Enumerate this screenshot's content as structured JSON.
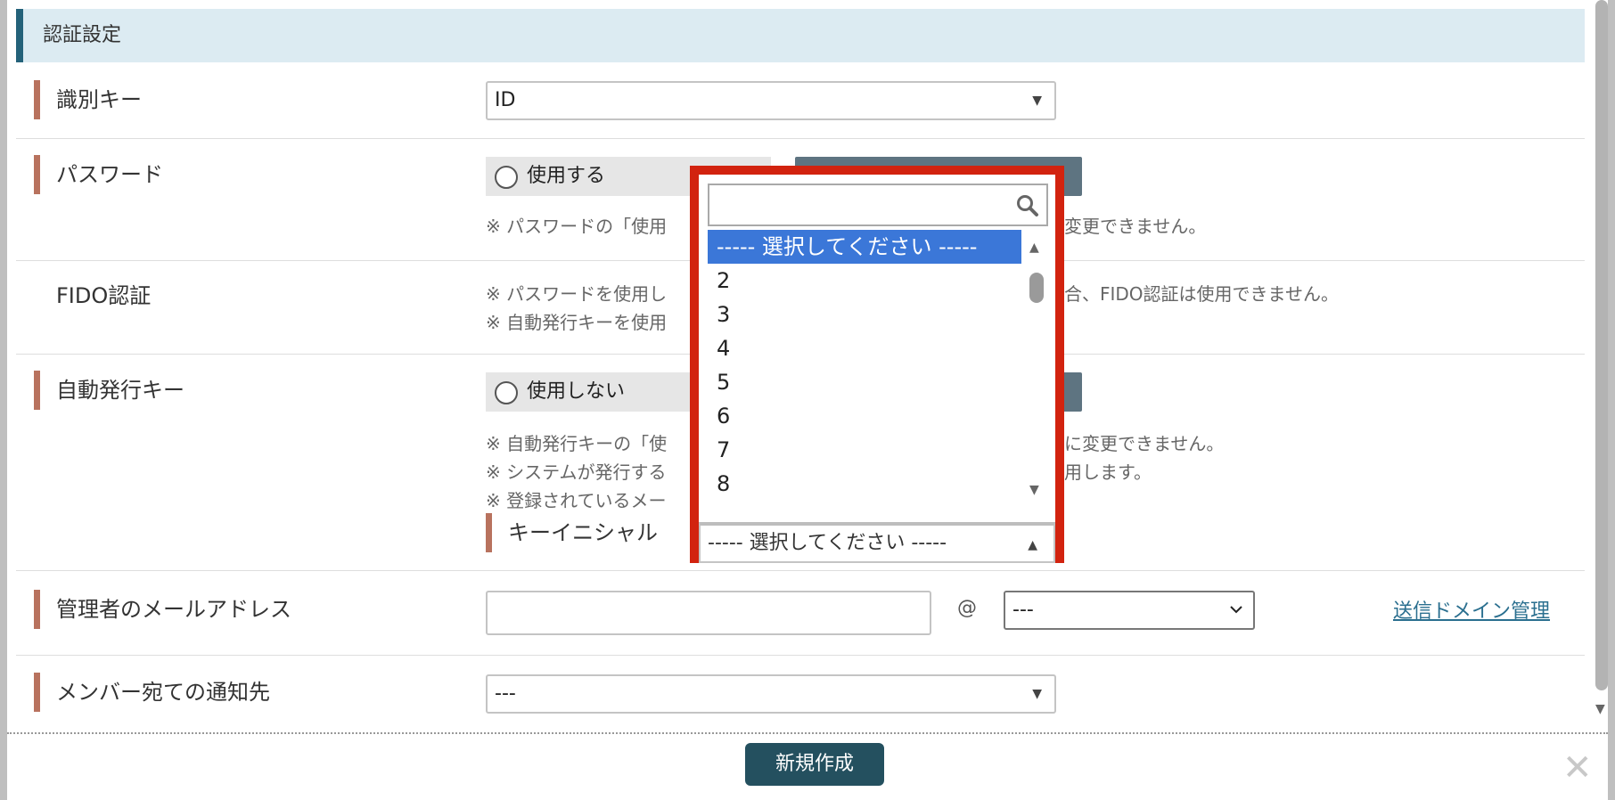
{
  "section": {
    "title": "認証設定"
  },
  "identifier_key": {
    "label": "識別キー",
    "value": "ID"
  },
  "password": {
    "label": "パスワード",
    "option_label": "使用する",
    "note": "※ パスワードの「使用",
    "note_tail": "変更できません。"
  },
  "fido": {
    "label": "FIDO認証",
    "note1": "※ パスワードを使用し",
    "note1_tail": "合、FIDO認証は使用できません。",
    "note2": "※ 自動発行キーを使用"
  },
  "auto_key": {
    "label": "自動発行キー",
    "option_label": "使用しない",
    "note1": "※ 自動発行キーの「使",
    "note1_tail": "に変更できません。",
    "note2": "※ システムが発行する",
    "note2_tail": "用します。",
    "note3": "※ 登録されているメー",
    "initial_label": "キーイニシャル",
    "initial_value": "----- 選択してください -----"
  },
  "dropdown": {
    "search_placeholder": "",
    "options": [
      "----- 選択してください -----",
      "2",
      "3",
      "4",
      "5",
      "6",
      "7",
      "8"
    ],
    "selected_index": 0
  },
  "admin_email": {
    "label": "管理者のメールアドレス",
    "value": "",
    "at": "@",
    "domain_value": "---",
    "link": "送信ドメイン管理"
  },
  "member_notify": {
    "label": "メンバー宛ての通知先",
    "value": "---"
  },
  "footer": {
    "create_button": "新規作成",
    "close": "✕"
  }
}
